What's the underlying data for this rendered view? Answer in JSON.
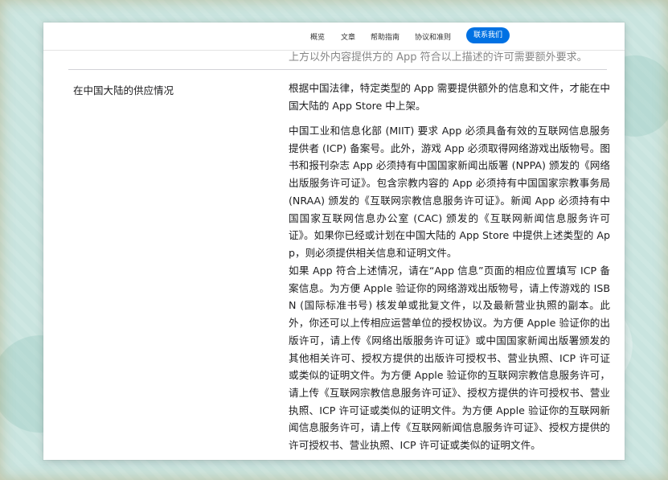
{
  "nav": {
    "items": [
      "概览",
      "文章",
      "帮助指南",
      "协议和准则"
    ],
    "cta": "联系我们"
  },
  "cut_line": "上方以外内容提供方的 App 符合以上描述的许可需要额外要求。",
  "section": {
    "label": "在中国大陆的供应情况",
    "paragraphs": [
      "根据中国法律，特定类型的 App 需要提供额外的信息和文件，才能在中国大陆的 App Store 中上架。",
      "中国工业和信息化部 (MIIT) 要求 App 必须具备有效的互联网信息服务提供者 (ICP) 备案号。此外，游戏 App 必须取得网络游戏出版物号。图书和报刊杂志 App 必须持有中国国家新闻出版署 (NPPA) 颁发的《网络出版服务许可证》。包含宗教内容的 App 必须持有中国国家宗教事务局 (NRAA) 颁发的《互联网宗教信息服务许可证》。新闻 App 必须持有中国国家互联网信息办公室 (CAC) 颁发的《互联网新闻信息服务许可证》。如果你已经或计划在中国大陆的 App Store 中提供上述类型的 App，则必须提供相关信息和证明文件。",
      "如果 App 符合上述情况，请在“App 信息”页面的相应位置填写 ICP 备案信息。为方便 Apple 验证你的网络游戏出版物号，请上传游戏的 ISBN (国际标准书号) 核发单或批复文件，以及最新营业执照的副本。此外，你还可以上传相应运营单位的授权协议。为方便 Apple 验证你的出版许可，请上传《网络出版服务许可证》或中国国家新闻出版署颁发的其他相关许可、授权方提供的出版许可授权书、营业执照、ICP 许可证或类似的证明文件。为方便 Apple 验证你的互联网宗教信息服务许可，请上传《互联网宗教信息服务许可证》、授权方提供的许可授权书、营业执照、ICP 许可证或类似的证明文件。为方便 Apple 验证你的互联网新闻信息服务许可，请上传《互联网新闻信息服务许可证》、授权方提供的许可授权书、营业执照、ICP 许可证或类似的证明文件。"
    ]
  },
  "colors": {
    "accent": "#0071e3",
    "text": "#1d1d1f",
    "background": "#c9e4df"
  }
}
